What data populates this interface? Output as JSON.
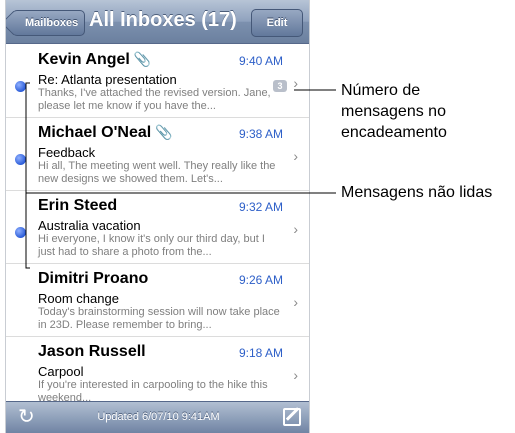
{
  "navbar": {
    "back_label": "Mailboxes",
    "title": "All Inboxes (17)",
    "edit_label": "Edit"
  },
  "messages": [
    {
      "sender": "Kevin Angel",
      "attachment": true,
      "time": "9:40 AM",
      "subject": "Re: Atlanta presentation",
      "preview": "Thanks, I've attached the revised version. Jane, please let me know if you have the...",
      "unread": true,
      "thread_count": "3"
    },
    {
      "sender": "Michael O'Neal",
      "attachment": true,
      "time": "9:38 AM",
      "subject": "Feedback",
      "preview": "Hi all, The meeting went well. They really like the new designs we showed them. Let's...",
      "unread": true,
      "thread_count": ""
    },
    {
      "sender": "Erin Steed",
      "attachment": false,
      "time": "9:32 AM",
      "subject": "Australia vacation",
      "preview": "Hi everyone, I know it's only our third day, but I just had to share a photo from the...",
      "unread": true,
      "thread_count": ""
    },
    {
      "sender": "Dimitri Proano",
      "attachment": false,
      "time": "9:26 AM",
      "subject": "Room change",
      "preview": "Today's brainstorming session will now take place in 23D. Please remember to bring...",
      "unread": false,
      "thread_count": ""
    },
    {
      "sender": "Jason Russell",
      "attachment": false,
      "time": "9:18 AM",
      "subject": "Carpool",
      "preview": "If you're interested in carpooling to the hike this weekend...",
      "unread": false,
      "thread_count": ""
    }
  ],
  "toolbar": {
    "updated_text": "Updated 6/07/10 9:41AM"
  },
  "callouts": {
    "thread_line1": "Número de",
    "thread_line2": "mensagens no",
    "thread_line3": "encadeamento",
    "unread": "Mensagens não lidas"
  },
  "icons": {
    "refresh": "refresh-icon",
    "compose": "compose-icon",
    "attachment": "paperclip-icon",
    "chevron": "chevron-right-icon"
  },
  "colors": {
    "unread_dot": "#2a5bd7",
    "time": "#2d5fc8",
    "navbar": "#7c90ae"
  }
}
